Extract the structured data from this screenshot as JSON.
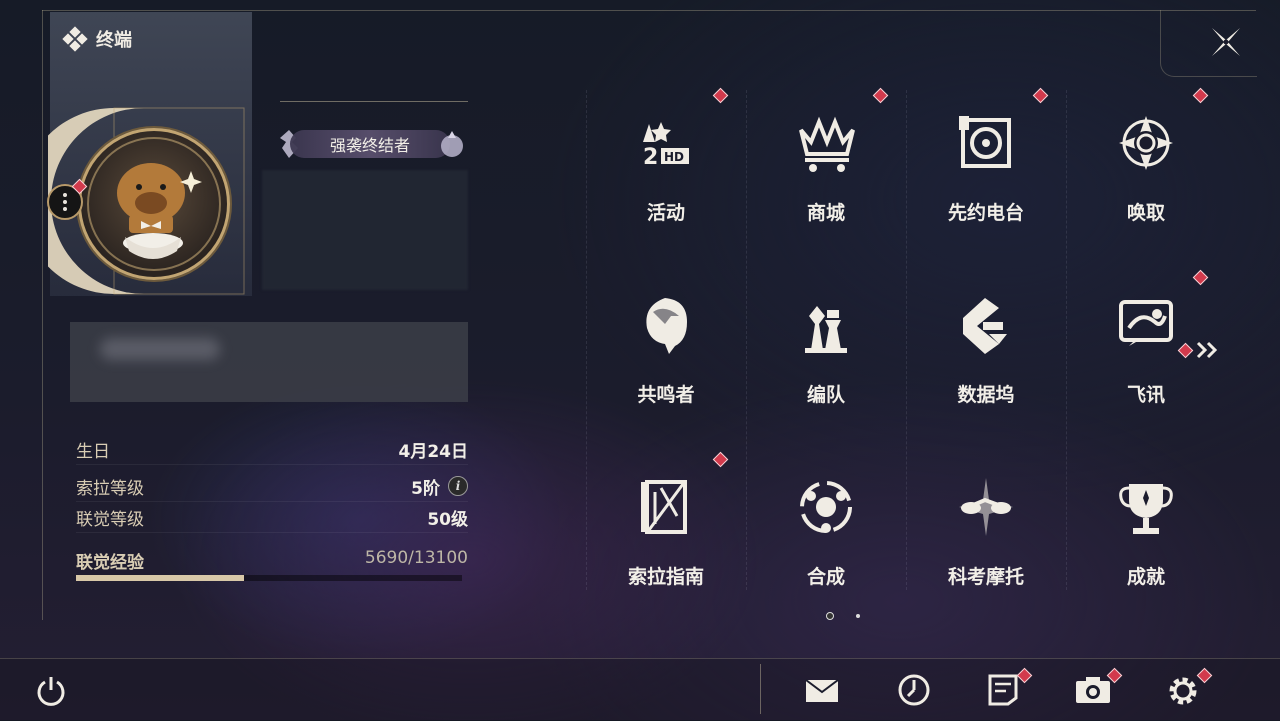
{
  "header": {
    "title": "终端"
  },
  "profile": {
    "title_badge": "强袭终结者",
    "stats": [
      {
        "label": "生日",
        "value": "4月24日"
      },
      {
        "label": "索拉等级",
        "value": "5阶"
      },
      {
        "label": "联觉等级",
        "value": "50级"
      }
    ],
    "exp": {
      "label": "联觉经验",
      "value": "5690/13100",
      "current": 5690,
      "max": 13100
    }
  },
  "menu": {
    "items": [
      {
        "label": "活动",
        "icon": "event-2nd-icon",
        "badge": true
      },
      {
        "label": "商城",
        "icon": "crown-cart-icon",
        "badge": true
      },
      {
        "label": "先约电台",
        "icon": "radio-icon",
        "badge": true
      },
      {
        "label": "唤取",
        "icon": "compass-star-icon",
        "badge": true
      },
      {
        "label": "共鸣者",
        "icon": "character-icon",
        "badge": false
      },
      {
        "label": "编队",
        "icon": "chess-team-icon",
        "badge": false
      },
      {
        "label": "数据坞",
        "icon": "data-dock-icon",
        "badge": false
      },
      {
        "label": "飞讯",
        "icon": "chat-icon",
        "badge": true
      },
      {
        "label": "索拉指南",
        "icon": "guide-book-icon",
        "badge": true
      },
      {
        "label": "合成",
        "icon": "synthesis-icon",
        "badge": false
      },
      {
        "label": "科考摩托",
        "icon": "motorbike-icon",
        "badge": false
      },
      {
        "label": "成就",
        "icon": "trophy-icon",
        "badge": false
      }
    ],
    "page": 1,
    "pages": 2
  },
  "bottom_bar": {
    "buttons": [
      "mail-icon",
      "clock-icon",
      "notice-icon",
      "camera-icon",
      "settings-icon"
    ]
  },
  "colors": {
    "accent_red": "#d23a4c",
    "gold": "#c2a572",
    "exp_fill": "#d8c8a8"
  }
}
